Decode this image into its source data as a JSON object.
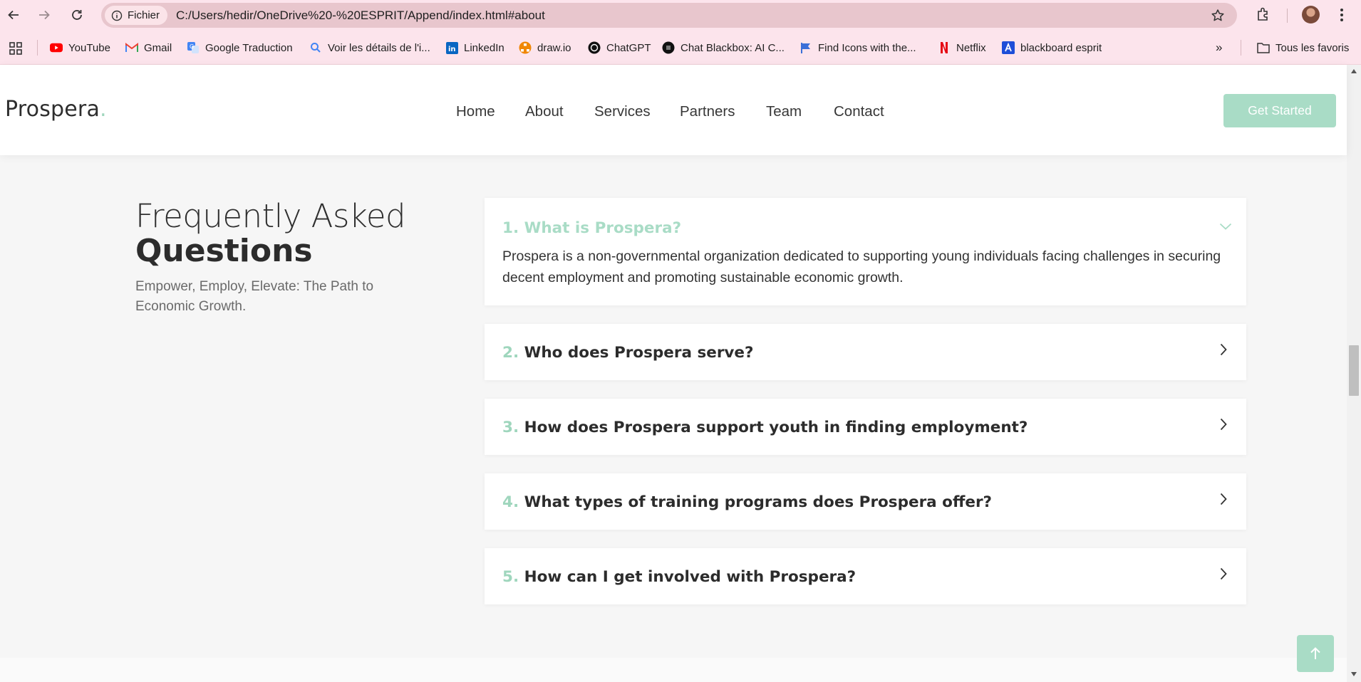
{
  "browser": {
    "site_chip": "Fichier",
    "url": "C:/Users/hedir/OneDrive%20-%20ESPRIT/Append/index.html#about",
    "bookmarks": [
      {
        "label": "YouTube",
        "icon": "youtube-icon"
      },
      {
        "label": "Gmail",
        "icon": "gmail-icon"
      },
      {
        "label": "Google Traduction",
        "icon": "google-translate-icon"
      },
      {
        "label": "Voir les détails de l'i...",
        "icon": "search-icon"
      },
      {
        "label": "LinkedIn",
        "icon": "linkedin-icon"
      },
      {
        "label": "draw.io",
        "icon": "drawio-icon"
      },
      {
        "label": "ChatGPT",
        "icon": "chatgpt-icon"
      },
      {
        "label": "Chat Blackbox: AI C...",
        "icon": "blackbox-icon"
      },
      {
        "label": "Find Icons with the...",
        "icon": "flag-icon"
      },
      {
        "label": "Netflix",
        "icon": "netflix-icon"
      },
      {
        "label": "blackboard esprit",
        "icon": "blackboard-icon"
      }
    ],
    "overflow": "»",
    "all_bookmarks": "Tous les favoris"
  },
  "header": {
    "logo": "Prospera",
    "logo_dot": ".",
    "nav": [
      "Home",
      "About",
      "Services",
      "Partners",
      "Team",
      "Contact"
    ],
    "cta": "Get Started"
  },
  "faq": {
    "title_light": "Frequently Asked",
    "title_bold": "Questions",
    "subtitle": "Empower, Employ, Elevate: The Path to Economic Growth.",
    "items": [
      {
        "num": "1.",
        "question": "What is Prospera?",
        "answer": "Prospera is a non-governmental organization dedicated to supporting young individuals facing challenges in securing decent employment and promoting sustainable economic growth.",
        "expanded": true
      },
      {
        "num": "2.",
        "question": "Who does Prospera serve?",
        "expanded": false
      },
      {
        "num": "3.",
        "question": "How does Prospera support youth in finding employment?",
        "expanded": false
      },
      {
        "num": "4.",
        "question": "What types of training programs does Prospera offer?",
        "expanded": false
      },
      {
        "num": "5.",
        "question": "How can I get involved with Prospera?",
        "expanded": false
      }
    ]
  },
  "colors": {
    "accent": "#a9dcc6",
    "chrome_bg": "#fce4ec",
    "text_dark": "#2c2c2c"
  }
}
